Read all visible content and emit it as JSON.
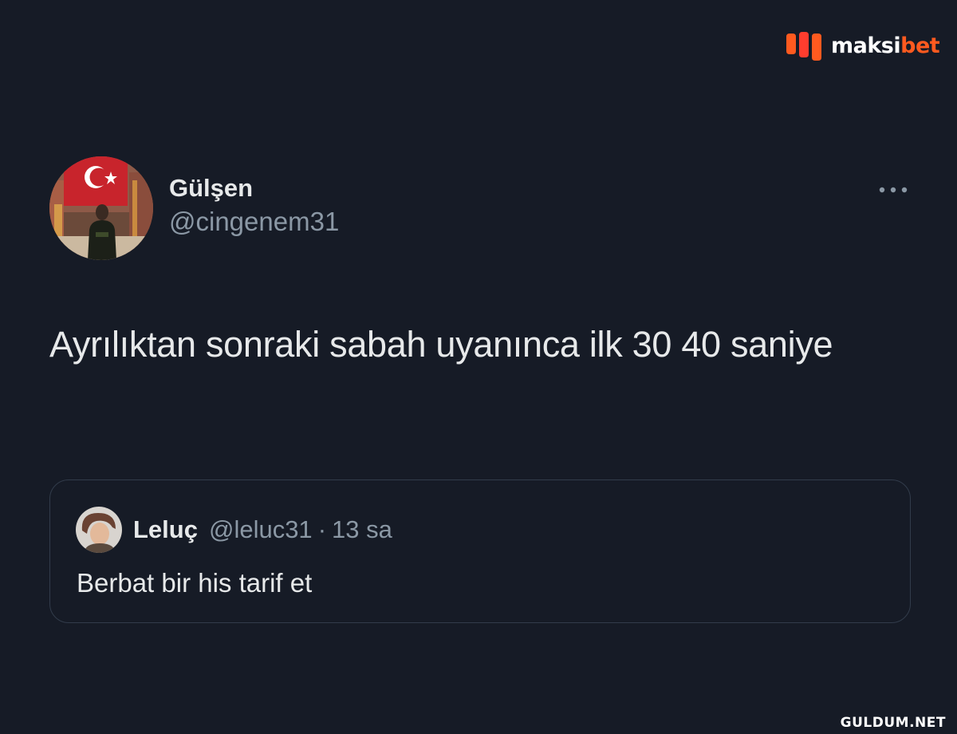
{
  "brand": {
    "logo_text_main": "maksi",
    "logo_text_accent": "bet",
    "accent_color": "#ff5a1f"
  },
  "tweet": {
    "display_name": "Gülşen",
    "handle": "@cingenem31",
    "text": "Ayrılıktan sonraki sabah uyanınca ilk 30 40 saniye",
    "avatar_icon": "profile-photo-turkish-flag",
    "more_icon": "ellipsis-icon"
  },
  "quoted_tweet": {
    "display_name": "Leluç",
    "handle": "@leluc31",
    "separator": "·",
    "time": "13 sa",
    "text": "Berbat bir his tarif et"
  },
  "watermark": "GULDUM.NET",
  "colors": {
    "background": "#161b26",
    "primary_text": "#e7e9ea",
    "secondary_text": "#8b98a5",
    "border": "#323c4b"
  }
}
